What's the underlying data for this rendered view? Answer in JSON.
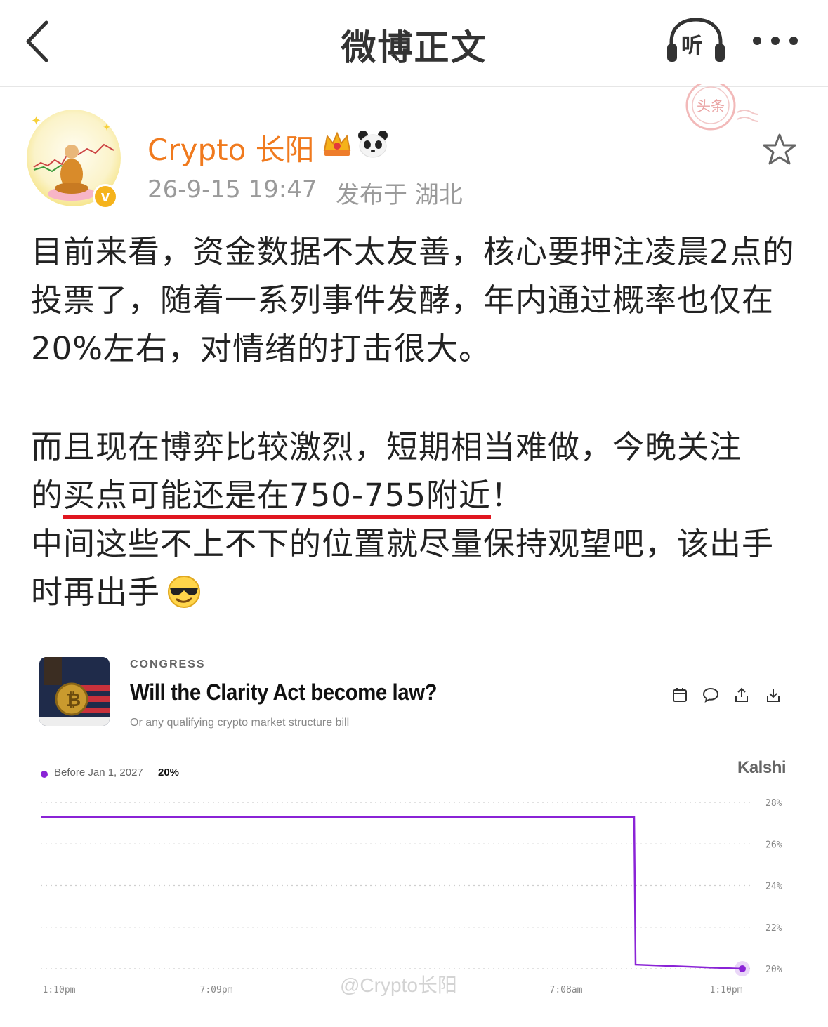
{
  "nav": {
    "title": "微博正文",
    "listen_label": "听"
  },
  "author": {
    "name": "Crypto 长阳",
    "verified_mark": "v",
    "time": "26-9-15 19:47",
    "location": "发布于 湖北"
  },
  "stamp_text": "头条",
  "post": {
    "p1": "目前来看，资金数据不太友善，核心要押注凌晨2点的投票了，随着一系列事件发酵，年内通过概率也仅在20%左右，对情绪的打击很大。",
    "p2_line1": "而且现在博弈比较激烈，短期相当难做，今晚关注",
    "p2_pre": "的",
    "p2_highlight": "买点可能还是在750-755附近",
    "p2_post": "！",
    "p3": "中间这些不上不下的位置就尽量保持观望吧，该出手时再出手"
  },
  "card": {
    "category": "CONGRESS",
    "title": "Will the Clarity Act become law?",
    "subtitle": "Or any qualifying crypto market structure bill",
    "legend_label": "Before Jan 1, 2027",
    "legend_value": "20%",
    "brand": "Kalshi",
    "watermark": "@Crypto长阳",
    "icons": [
      "calendar-icon",
      "comment-icon",
      "share-icon",
      "download-icon"
    ]
  },
  "colors": {
    "accent_orange": "#f07a1e",
    "series_purple": "#8a23d6",
    "underline_red": "#e0161f"
  },
  "chart_data": {
    "type": "line",
    "series": [
      {
        "name": "Before Jan 1, 2027",
        "x": [
          "1:10pm",
          "7:09pm",
          "7:08am",
          "1:10pm"
        ],
        "points": [
          {
            "x": "1:10pm",
            "y": 27.3
          },
          {
            "x": "7:08am+",
            "y": 27.3
          },
          {
            "x": "7:08am+",
            "y": 20.2
          },
          {
            "x": "1:10pm",
            "y": 20
          }
        ]
      }
    ],
    "x_tick_labels": [
      "1:10pm",
      "7:09pm",
      "7:08am",
      "1:10pm"
    ],
    "y_tick_labels": [
      "28%",
      "26%",
      "24%",
      "22%",
      "20%"
    ],
    "ylim": [
      20,
      28
    ],
    "grid": true
  }
}
